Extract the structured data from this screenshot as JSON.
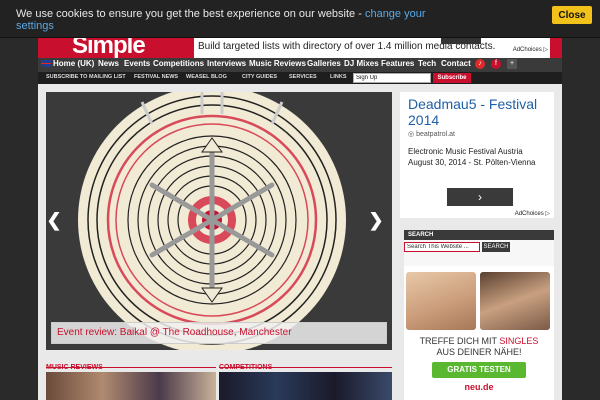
{
  "cookie": {
    "message": "We use cookies to ensure you get the best experience on our website - ",
    "link": "change your settings",
    "close_label": "Close"
  },
  "header": {
    "logo_text": "Simple",
    "ad_text": "Build targeted lists with directory of over 1.4 million media contacts.",
    "ad_choices": "AdChoices ▷"
  },
  "nav": {
    "items": [
      "Home (UK)",
      "News",
      "Events",
      "Competitions",
      "Interviews",
      "Music Reviews",
      "Galleries",
      "DJ Mixes",
      "Features",
      "Tech",
      "Contact"
    ]
  },
  "subnav": {
    "items": [
      "SUBSCRIBE TO MAILING LIST",
      "FESTIVAL NEWS",
      "WEASEL BLOG",
      "CITY GUIDES",
      "SERVICES",
      "LINKS"
    ],
    "signup_value": "Sign Up",
    "subscribe_label": "Subscribe"
  },
  "slider": {
    "caption": "Event review: Baikal @ The Roadhouse, Manchester",
    "prev": "❮",
    "next": "❯"
  },
  "sections": {
    "music_reviews": "MUSIC REVIEWS",
    "competitions": "COMPETITIONS"
  },
  "right_ad": {
    "title": "Deadmau5 - Festival 2014",
    "domain": "beatpatrol.at",
    "description": "Electronic Music Festival Austria August 30, 2014 - St. Pölten-Vienna",
    "go": "›",
    "ad_choices": "AdChoices ▷"
  },
  "search": {
    "heading": "SEARCH",
    "input_value": "Search This Website ...",
    "button_label": "SEARCH"
  },
  "dating_ad": {
    "line1_pre": "TREFFE DICH MIT ",
    "line1_highlight": "SINGLES",
    "line2": "AUS DEINER NÄHE!",
    "cta": "GRATIS TESTEN",
    "brand": "neu.de"
  },
  "colors": {
    "brand_red": "#c8102e",
    "cookie_button": "#f3c21a",
    "link_blue": "#5aa9e6",
    "cta_green": "#59b830"
  }
}
